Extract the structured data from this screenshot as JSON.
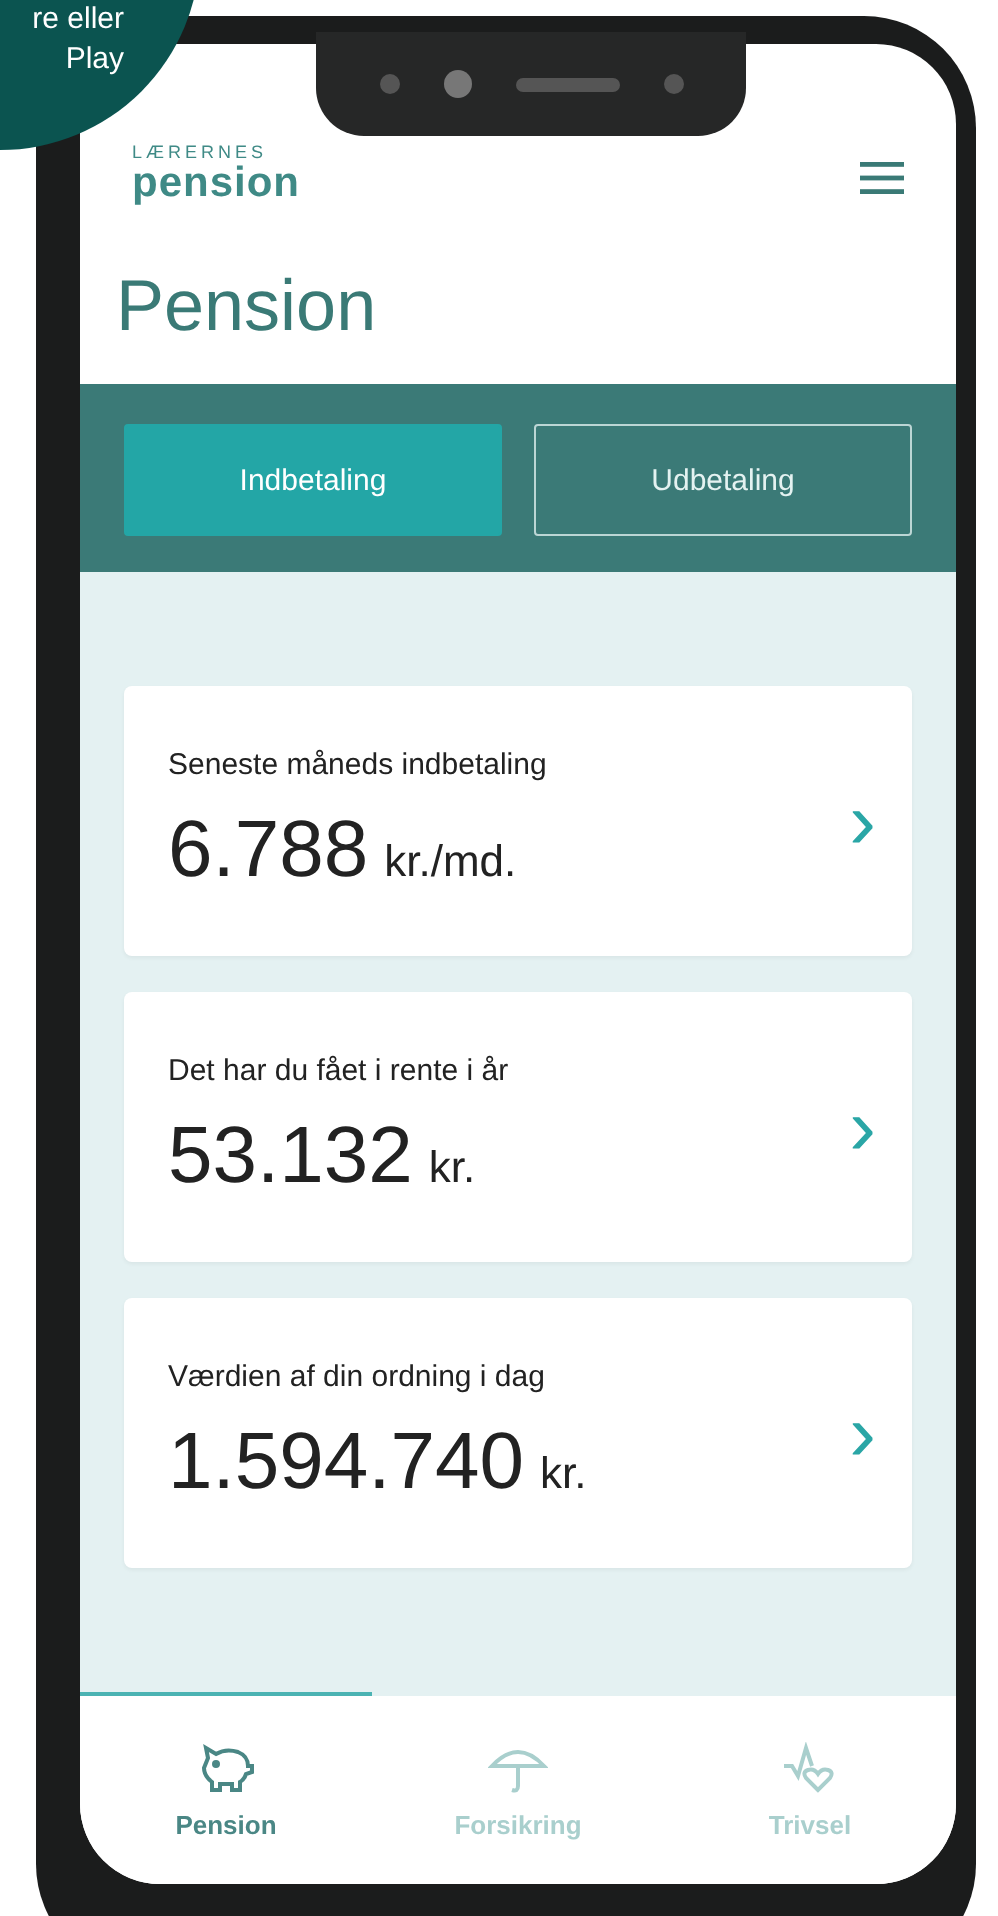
{
  "promo_badge": {
    "lines": [
      "re eller",
      "Play"
    ]
  },
  "header": {
    "logo_top": "LÆRERNES",
    "logo_bottom": "pension"
  },
  "title": "Pension",
  "tabs": [
    {
      "label": "Indbetaling",
      "selected": true
    },
    {
      "label": "Udbetaling",
      "selected": false
    }
  ],
  "cards": [
    {
      "label": "Seneste måneds indbetaling",
      "amount": "6.788",
      "unit": "kr./md.",
      "chevron": "›"
    },
    {
      "label": "Det har du fået i rente i år",
      "amount": "53.132",
      "unit": "kr.",
      "chevron": "›"
    },
    {
      "label": "Værdien af din ordning i dag",
      "amount": "1.594.740",
      "unit": "kr.",
      "chevron": "›"
    }
  ],
  "bottom_nav": [
    {
      "kind": "piggy",
      "label": "Pension",
      "selected": true
    },
    {
      "kind": "umbrella",
      "label": "Forsikring",
      "selected": false
    },
    {
      "kind": "heart",
      "label": "Trivsel",
      "selected": false
    }
  ]
}
